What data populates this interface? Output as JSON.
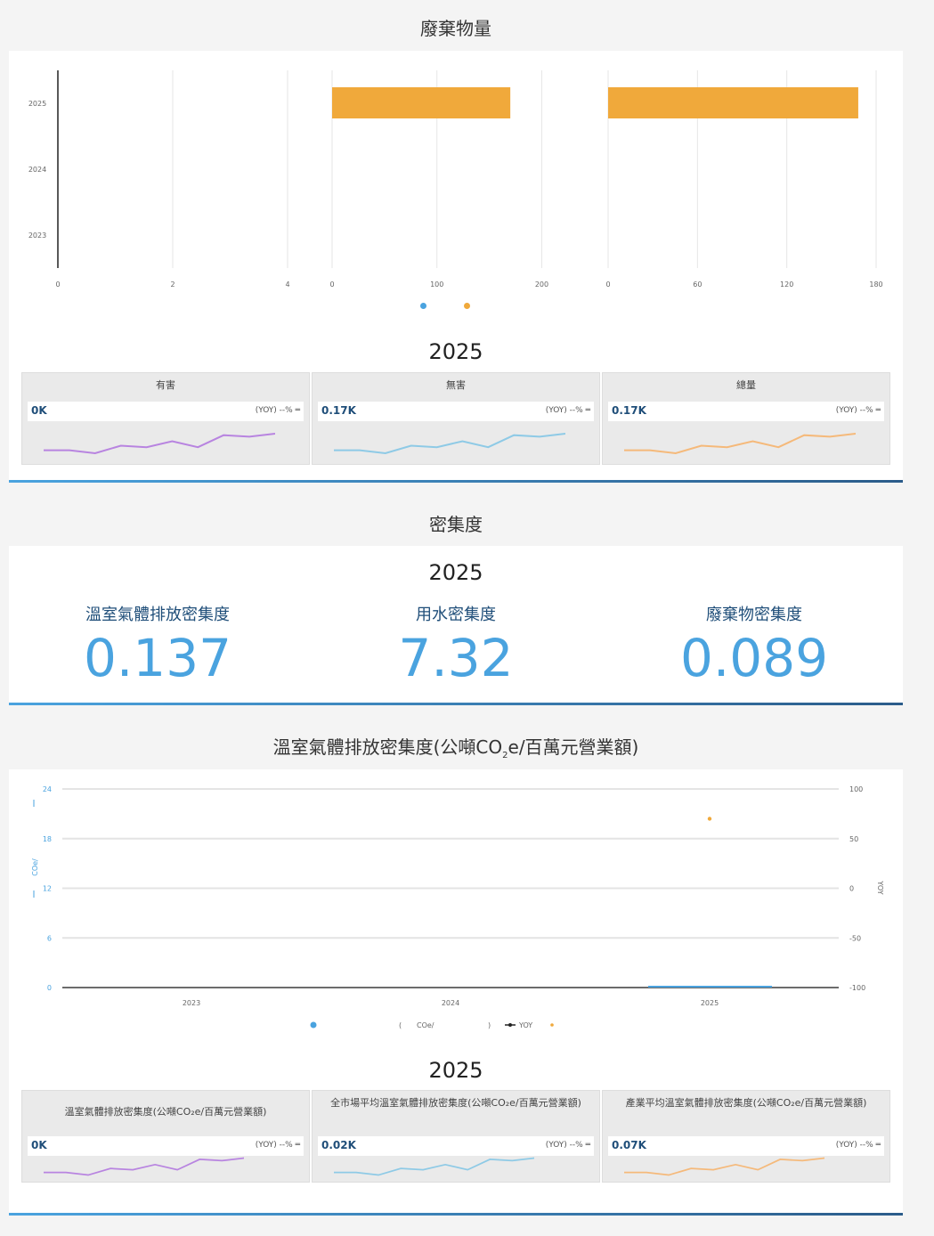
{
  "waste": {
    "title": "廢棄物量",
    "chart_data": {
      "type": "bar",
      "orientation": "horizontal",
      "categories": [
        "2025",
        "2024",
        "2023"
      ],
      "panels": [
        {
          "ticks": [
            "0",
            "2",
            "4"
          ],
          "xlim": [
            0,
            4
          ],
          "values": [
            0,
            null,
            null
          ]
        },
        {
          "ticks": [
            "0",
            "100",
            "200"
          ],
          "xlim": [
            0,
            220
          ],
          "values": [
            170,
            null,
            null
          ],
          "color": "#f0a93b"
        },
        {
          "ticks": [
            "0",
            "60",
            "120",
            "180"
          ],
          "xlim": [
            0,
            180
          ],
          "values": [
            168,
            null,
            null
          ],
          "color": "#f0a93b"
        }
      ],
      "legend": [
        {
          "color": "#4aa3df"
        },
        {
          "color": "#f0a93b"
        }
      ]
    },
    "year": "2025",
    "cards": [
      {
        "title": "有害",
        "value": "0K",
        "yoy": "(YOY) --% ═",
        "color": "#b884e0"
      },
      {
        "title": "無害",
        "value": "0.17K",
        "yoy": "(YOY) --% ═",
        "color": "#8ecae6"
      },
      {
        "title": "總量",
        "value": "0.17K",
        "yoy": "(YOY) --% ═",
        "color": "#f5b97a"
      }
    ]
  },
  "density": {
    "title": "密集度",
    "year": "2025",
    "metrics": [
      {
        "label": "溫室氣體排放密集度",
        "value": "0.137"
      },
      {
        "label": "用水密集度",
        "value": "7.32"
      },
      {
        "label": "廢棄物密集度",
        "value": "0.089"
      }
    ]
  },
  "ghg": {
    "title_pre": "溫室氣體排放密集度(公噸CO",
    "title_sub": "2",
    "title_post": "e/百萬元營業額)",
    "chart_data": {
      "type": "line",
      "x": [
        "2023",
        "2024",
        "2025"
      ],
      "y_left_ticks": [
        "0",
        "6",
        "12",
        "18",
        "24"
      ],
      "y_left_lim": [
        0,
        24
      ],
      "y_right_ticks": [
        "-100",
        "-50",
        "0",
        "50",
        "100"
      ],
      "y_right_lim": [
        -100,
        100
      ],
      "series": [
        {
          "values": [
            0,
            0,
            0.137
          ],
          "color": "#4aa3df"
        },
        {
          "name": "YOY",
          "axis": "right",
          "values": [
            null,
            null,
            70
          ],
          "color": "#f0a93b"
        }
      ],
      "left_axis_label": "COe/",
      "right_axis_label": "YOY",
      "legend": [
        {
          "text": "(",
          "color": "#4aa3df"
        },
        {
          "text": "COe/"
        },
        {
          "text": ")"
        },
        {
          "text": "YOY",
          "color": "#222"
        },
        {
          "text": "",
          "color": "#f0a93b"
        }
      ]
    },
    "year": "2025",
    "cards": [
      {
        "title": "溫室氣體排放密集度(公噸CO₂e/百萬元營業額)",
        "value": "0K",
        "yoy": "(YOY) --% ═",
        "color": "#b884e0"
      },
      {
        "title": "全市場平均溫室氣體排放密集度(公噸CO₂e/百萬元營業額)",
        "value": "0.02K",
        "yoy": "(YOY) --% ═",
        "color": "#8ecae6"
      },
      {
        "title": "產業平均溫室氣體排放密集度(公噸CO₂e/百萬元營業額)",
        "value": "0.07K",
        "yoy": "(YOY) --% ═",
        "color": "#f5b97a"
      }
    ]
  },
  "sparkline": [
    5,
    5,
    3,
    8,
    7,
    11,
    7,
    15,
    14,
    16
  ]
}
